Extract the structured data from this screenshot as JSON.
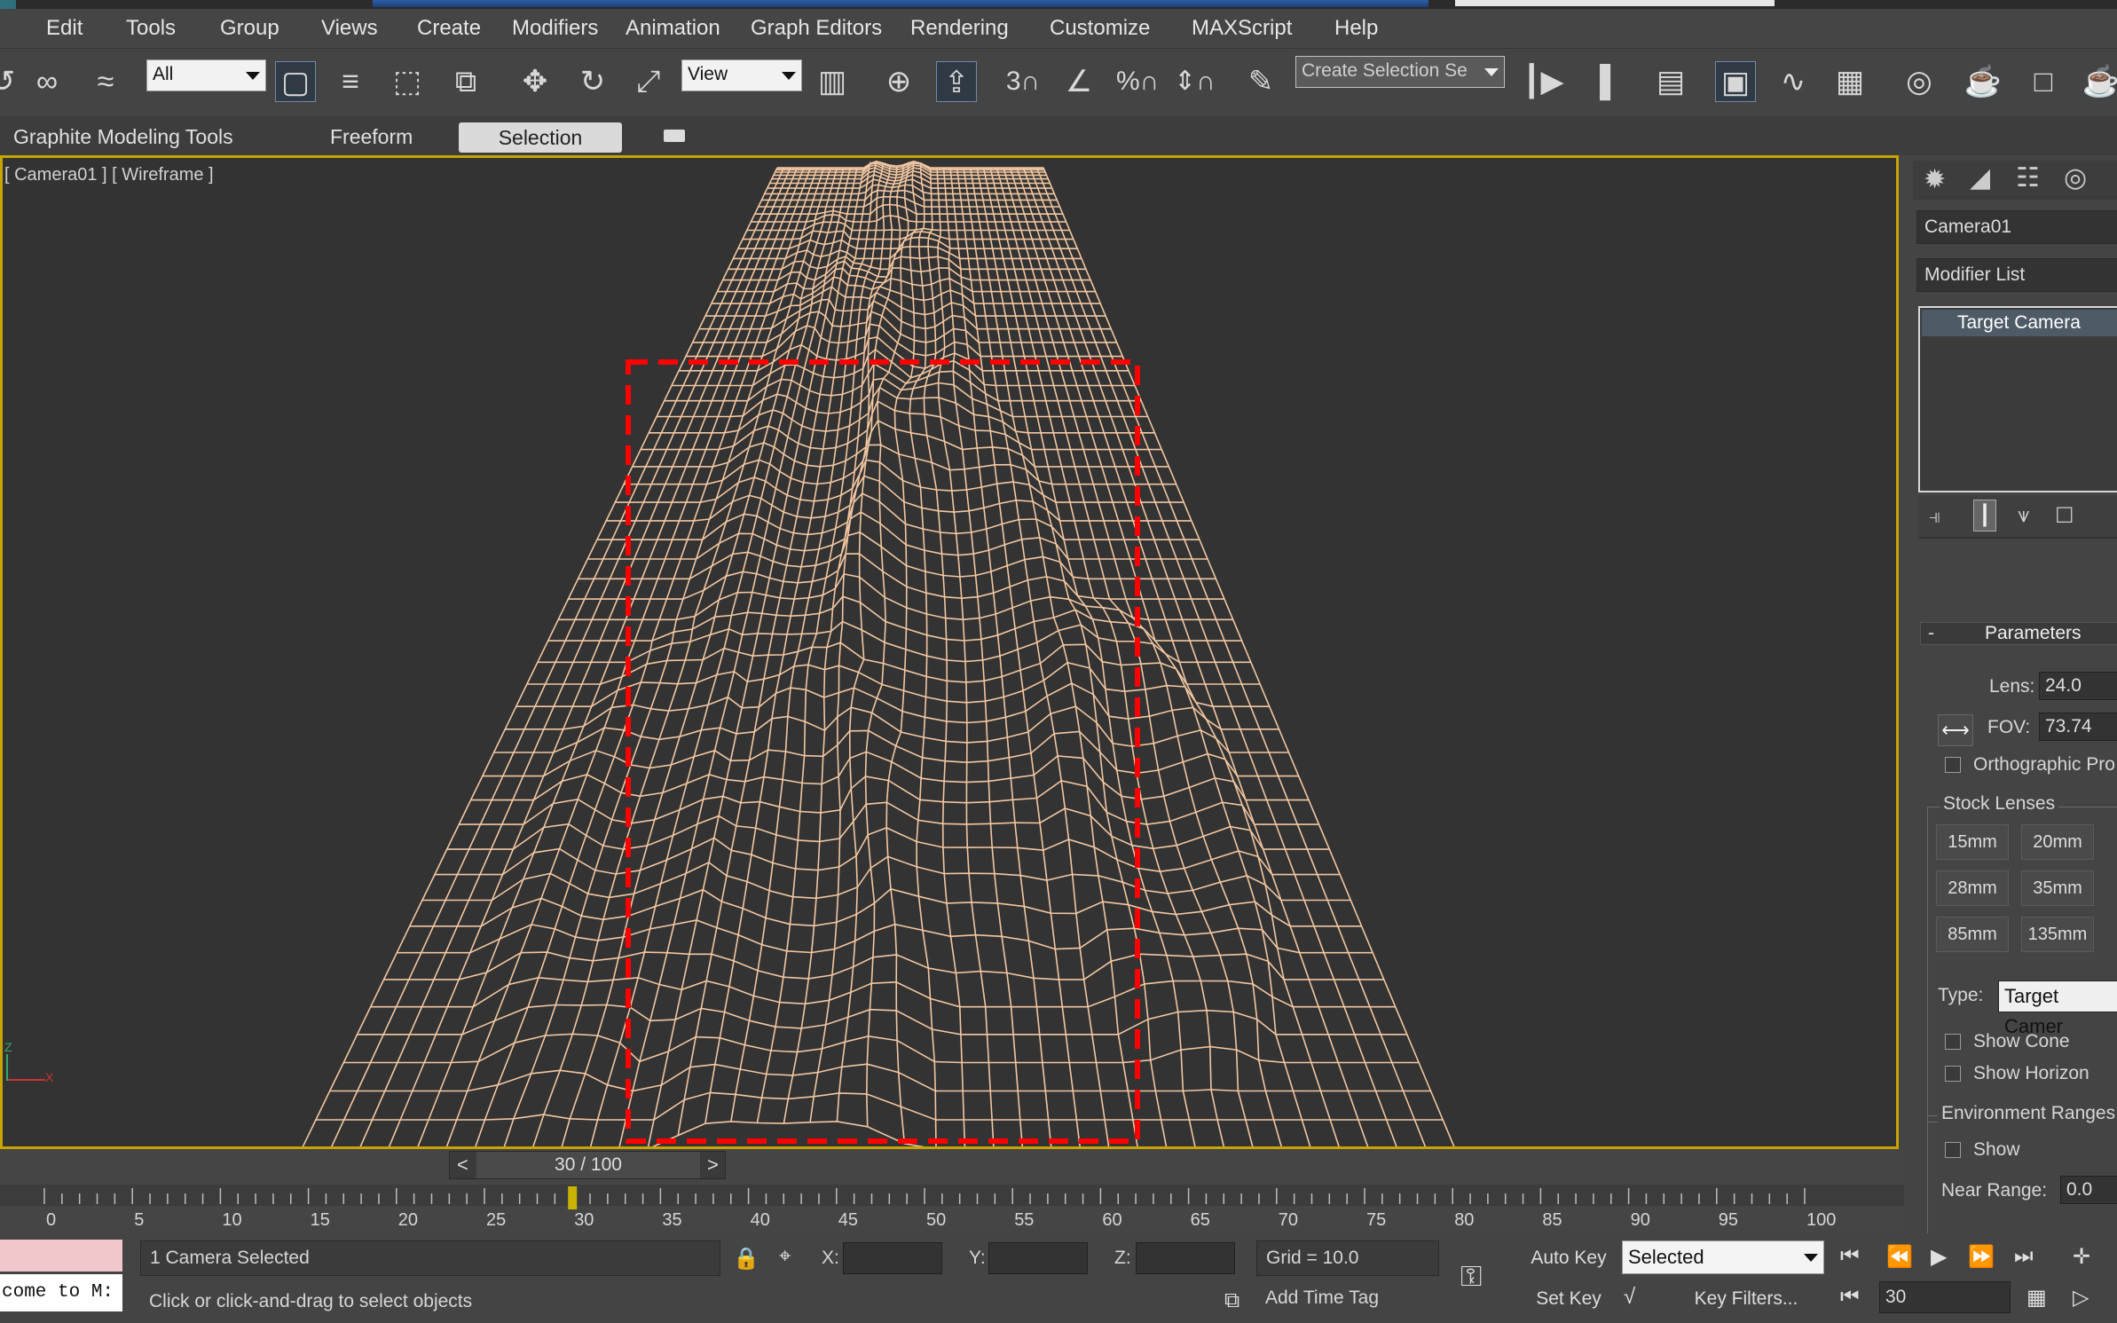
{
  "menu": [
    "Edit",
    "Tools",
    "Group",
    "Views",
    "Create",
    "Modifiers",
    "Animation",
    "Graph Editors",
    "Rendering",
    "Customize",
    "MAXScript",
    "Help"
  ],
  "toolbar": {
    "selection_filter": "All",
    "ref_coord": "View",
    "named_selection_placeholder": "Create Selection Se"
  },
  "ribbon": {
    "tabs": [
      "Graphite Modeling Tools",
      "Freeform",
      "Selection"
    ]
  },
  "viewport": {
    "label": "[ Camera01 ] [ Wireframe ]",
    "axis_x": "X",
    "axis_z": "Z",
    "wire_color": "#f2c7a2",
    "selection_color": "#ff0000"
  },
  "command_panel": {
    "object_name": "Camera01",
    "modifier_list": "Modifier List",
    "stack_item": "Target Camera",
    "parameters_title": "Parameters",
    "collapse": "-",
    "lens_label": "Lens:",
    "lens_value": "24.0",
    "fov_label": "FOV:",
    "fov_value": "73.74",
    "ortho_label": "Orthographic Pro",
    "stock_lenses_label": "Stock Lenses",
    "lenses": [
      "15mm",
      "20mm",
      "28mm",
      "35mm",
      "85mm",
      "135mm"
    ],
    "type_label": "Type:",
    "type_value": "Target Camer",
    "show_cone": "Show Cone",
    "show_horizon": "Show Horizon",
    "env_ranges": "Environment Ranges",
    "show": "Show",
    "near_range_label": "Near Range:",
    "near_range_value": "0.0"
  },
  "timeline": {
    "frame_display": "30 / 100",
    "current_frame": 30,
    "total_frames": 100,
    "prev": "<",
    "next": ">",
    "ticks": [
      "0",
      "5",
      "10",
      "15",
      "20",
      "25",
      "30",
      "35",
      "40",
      "45",
      "50",
      "55",
      "60",
      "65",
      "70",
      "75",
      "80",
      "85",
      "90",
      "95",
      "100"
    ]
  },
  "status": {
    "script_listener": "come to M:",
    "selection_info": "1 Camera Selected",
    "prompt": "Click or click-and-drag to select objects",
    "x_label": "X:",
    "y_label": "Y:",
    "z_label": "Z:",
    "grid": "Grid = 10.0",
    "add_time_tag": "Add Time Tag",
    "auto_key": "Auto Key",
    "set_key": "Set Key",
    "key_mode": "Selected",
    "key_filters": "Key Filters...",
    "frame_field": "30"
  }
}
